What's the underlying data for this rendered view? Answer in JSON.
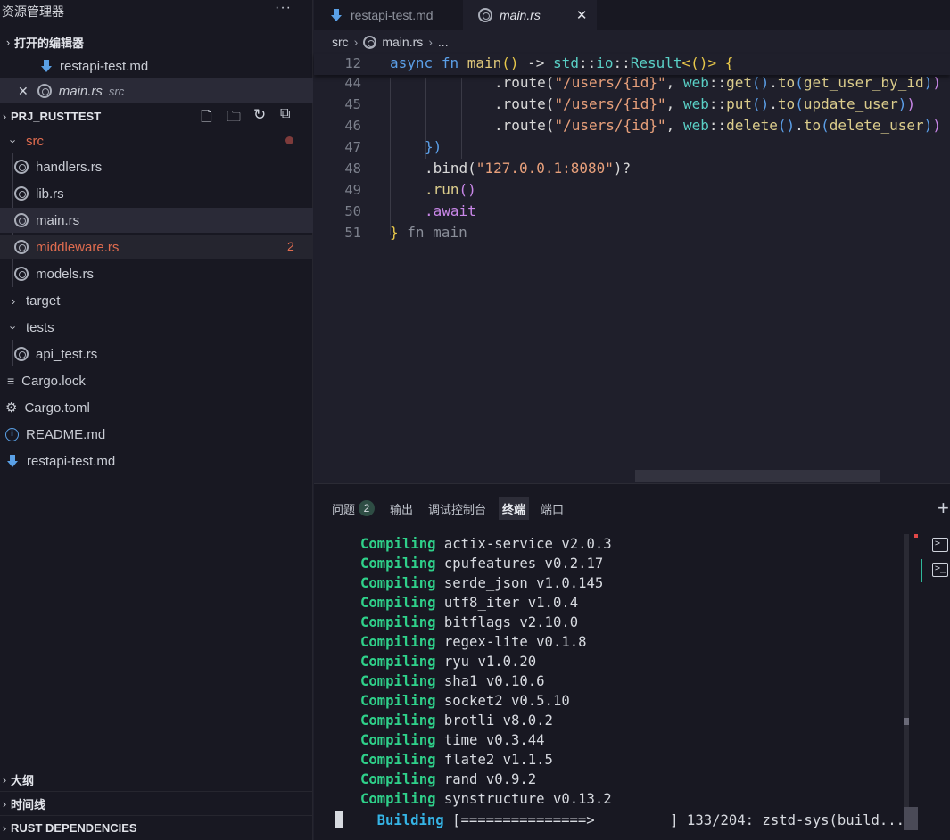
{
  "sidebar": {
    "title": "资源管理器",
    "more": "···",
    "open_editors": {
      "title": "打开的编辑器",
      "items": [
        {
          "name": "restapi-test.md"
        },
        {
          "name": "main.rs",
          "hint": "src",
          "close": "✕"
        }
      ]
    },
    "project": {
      "title": "PRJ_RUSTTEST",
      "tree": {
        "src": "src",
        "handlers": "handlers.rs",
        "lib": "lib.rs",
        "main": "main.rs",
        "middleware": "middleware.rs",
        "middleware_problems": "2",
        "models": "models.rs",
        "target": "target",
        "tests": "tests",
        "api_test": "api_test.rs",
        "cargo_lock": "Cargo.lock",
        "cargo_toml": "Cargo.toml",
        "readme": "README.md",
        "restapi_md": "restapi-test.md"
      }
    },
    "outline": "大纲",
    "timeline": "时间线",
    "rust_deps": "RUST DEPENDENCIES"
  },
  "tabs": [
    {
      "label": "restapi-test.md"
    },
    {
      "label": "main.rs",
      "close": "✕"
    }
  ],
  "breadcrumb": [
    "src",
    "main.rs",
    "..."
  ],
  "editor": {
    "line_numbers": [
      "12",
      "44",
      "45",
      "46",
      "47",
      "48",
      "49",
      "50",
      "51"
    ],
    "l12": {
      "async": "async",
      "fn": "fn",
      "name": "main",
      "paren": "()",
      "arrow": " -> ",
      "std": "std",
      "io": "io",
      "result": "Result",
      "rest": "<()> {"
    },
    "l44": {
      "route": ".route(",
      "path": "\"/users/{id}\"",
      "web": "web",
      "method": "get",
      "to": "to",
      "handler": "get_user_by_id"
    },
    "l45": {
      "route": ".route(",
      "path": "\"/users/{id}\"",
      "web": "web",
      "method": "put",
      "to": "to",
      "handler": "update_user"
    },
    "l46": {
      "route": ".route(",
      "path": "\"/users/{id}\"",
      "web": "web",
      "method": "delete",
      "to": "to",
      "handler": "delete_user"
    },
    "l47": "})",
    "l48": {
      "bind": ".bind(",
      "addr": "\"127.0.0.1:8080\"",
      "end": ")?"
    },
    "l49": {
      "run": ".run",
      "paren": "()"
    },
    "l50": ".await",
    "l51": {
      "brace": "}",
      "hint": " fn main"
    }
  },
  "panel": {
    "tabs": {
      "problems": "问题",
      "problems_count": "2",
      "output": "输出",
      "debug": "调试控制台",
      "terminal": "终端",
      "ports": "端口"
    },
    "add": "+",
    "compile_keyword": "Compiling",
    "compiling": [
      "actix-service v2.0.3",
      "cpufeatures v0.2.17",
      "serde_json v1.0.145",
      "utf8_iter v1.0.4",
      "bitflags v2.10.0",
      "regex-lite v0.1.8",
      "ryu v1.0.20",
      "sha1 v0.10.6",
      "socket2 v0.5.10",
      "brotli v8.0.2",
      "time v0.3.44",
      "flate2 v1.1.5",
      "rand v0.9.2",
      "synstructure v0.13.2"
    ],
    "building_keyword": "Building",
    "building_text": "[===============>         ] 133/204: zstd-sys(build..."
  },
  "colors": {
    "compiling": "#2fd08a",
    "building": "#35b4e6",
    "error": "#e06c4f"
  }
}
